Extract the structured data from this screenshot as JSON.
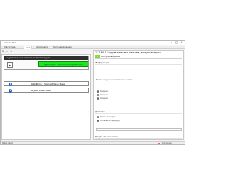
{
  "window": {
    "title": "Service Tool"
  },
  "tabs": [
    {
      "label": "Подсистема"
    },
    {
      "label": "Тест"
    },
    {
      "label": "Калибровать"
    },
    {
      "label": "Программирование"
    }
  ],
  "toolbar": {
    "icons": [
      "wrench-icon",
      "search-icon",
      "zoom-out-icon"
    ]
  },
  "procedure": {
    "header": "Гидравлическая система, выпуск воздуха",
    "action_label": "Проверка завершена успешно"
  },
  "items": [
    {
      "label": "LNG Pump 1 Solenoid Valve State"
    },
    {
      "label": "Bypass Valve State"
    }
  ],
  "details": {
    "title": "177-60-2 Гидравлическая система, выпуск воздуха",
    "result_label": "Воспроизведение",
    "sections": {
      "info": "Информация",
      "action": "Действие",
      "results": "Результат испытания"
    },
    "info_text": "Выпуск воздуха из гидравлической системы",
    "options": [
      {
        "label": "Сведения"
      },
      {
        "label": "Сведения"
      },
      {
        "label": "Сведения"
      }
    ],
    "action_options": [
      {
        "label": "Начать процедуру"
      },
      {
        "label": "Остановить процедуру"
      }
    ]
  },
  "status": {
    "left": "Status: Ready",
    "right": "Подключено"
  }
}
